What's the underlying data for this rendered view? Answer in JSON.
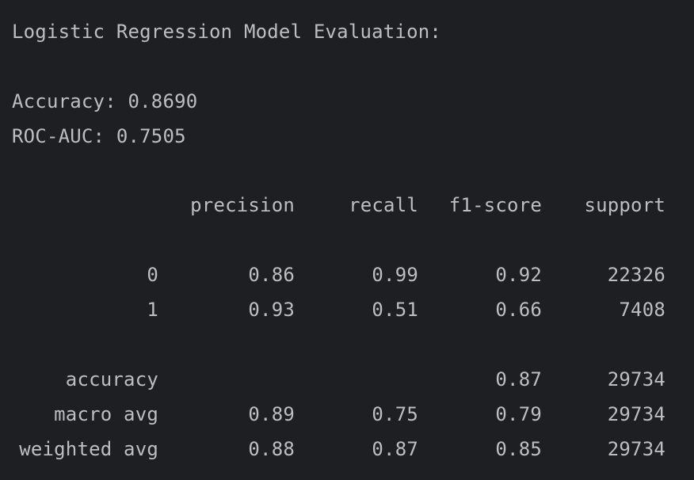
{
  "title": "Logistic Regression Model Evaluation:",
  "accuracy_line": "Accuracy: 0.8690",
  "roc_auc_line": "ROC-AUC: 0.7505",
  "report": {
    "headers": {
      "precision": "precision",
      "recall": "recall",
      "f1": "f1-score",
      "support": "support"
    },
    "rows": [
      {
        "label": "0",
        "precision": "0.86",
        "recall": "0.99",
        "f1": "0.92",
        "support": "22326"
      },
      {
        "label": "1",
        "precision": "0.93",
        "recall": "0.51",
        "f1": "0.66",
        "support": "7408"
      }
    ],
    "summary": [
      {
        "label": "accuracy",
        "precision": "",
        "recall": "",
        "f1": "0.87",
        "support": "29734"
      },
      {
        "label": "macro avg",
        "precision": "0.89",
        "recall": "0.75",
        "f1": "0.79",
        "support": "29734"
      },
      {
        "label": "weighted avg",
        "precision": "0.88",
        "recall": "0.87",
        "f1": "0.85",
        "support": "29734"
      }
    ]
  },
  "colors": {
    "background": "#1e1f22",
    "text": "#bcbec4"
  }
}
